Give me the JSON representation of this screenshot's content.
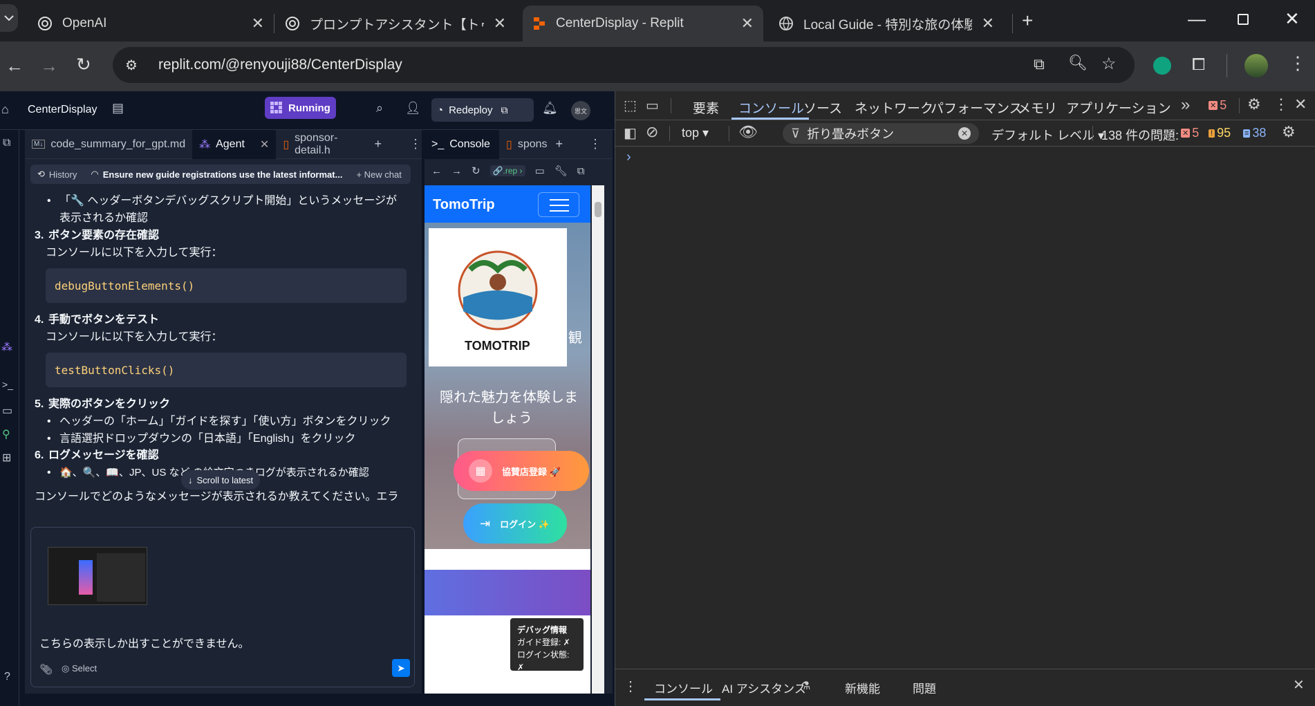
{
  "browser": {
    "tabs": [
      {
        "title": "OpenAI"
      },
      {
        "title": "プロンプトアシスタント【トゥモロープル"
      },
      {
        "title": "CenterDisplay - Replit"
      },
      {
        "title": "Local Guide - 特別な旅の体験を"
      }
    ],
    "url": "replit.com/@renyouji88/CenterDisplay"
  },
  "replit": {
    "project_name": "CenterDisplay",
    "running_label": "Running",
    "redeploy_label": "Redeploy",
    "avatar_text": "恩文",
    "left_tabs": [
      {
        "label": "code_summary_for_gpt.md"
      },
      {
        "label": "Agent"
      },
      {
        "label": "sponsor-detail.h"
      }
    ],
    "history_label": "History",
    "chat_title": "Ensure new guide registrations use the latest informat...",
    "new_chat_label": "New chat",
    "messages": {
      "b1": "「🔧 ヘッダーボタンデバッグスクリプト開始」というメッセージが",
      "b1b": "表示されるか確認",
      "s3_num": "3.",
      "s3_title": "ボタン要素の存在確認",
      "s3_sub": "コンソールに以下を入力して実行：",
      "code1": "debugButtonElements()",
      "s4_num": "4.",
      "s4_title": "手動でボタンをテスト",
      "s4_sub": "コンソールに以下を入力して実行：",
      "code2": "testButtonClicks()",
      "s5_num": "5.",
      "s5_title": "実際のボタンをクリック",
      "s5_b1": "ヘッダーの「ホーム」「ガイドを探す」「使い方」ボタンをクリック",
      "s5_b2": "言語選択ドロップダウンの「日本語」「English」をクリック",
      "s6_num": "6.",
      "s6_title": "ログメッセージを確認",
      "s6_b1": "🏠、🔍、📖、JP、US など の絵文字つきログが表示されるか確認",
      "bottom": "コンソールでどのようなメッセージが表示されるか教えてください。エラ"
    },
    "scroll_latest": "Scroll to latest",
    "input_text": "こちらの表示しか出すことができません。",
    "select_label": "Select",
    "right_tabs": [
      {
        "label": "Console"
      },
      {
        "label": "spons"
      }
    ],
    "webview_url": ".rep",
    "webview": {
      "brand": "TomoTrip",
      "logo_text": "TOMOTRIP",
      "hero_text": "隠れた魅力を体験しま",
      "hero_text2": "しょう",
      "hero_side": "観",
      "sponsor_btn": "協賛店登録 🚀",
      "login_btn": "ログイン ✨",
      "debug_title": "デバッグ情報",
      "debug_line1": "ガイド登録: ✗",
      "debug_line2": "ログイン状態: ✗"
    }
  },
  "devtools": {
    "tabs": [
      "要素",
      "コンソール",
      "ソース",
      "ネットワーク",
      "パフォーマンス",
      "メモリ",
      "アプリケーション"
    ],
    "error_badge": "5",
    "context": "top",
    "filter_text": "折り畳みボタン",
    "level": "デフォルト レベル",
    "issues_label": "138 件の問題:",
    "issue_errors": "5",
    "issue_warnings": "95",
    "issue_info": "38",
    "prompt": "›",
    "drawer_tabs": [
      "コンソール",
      "AI アシスタンス",
      "新機能",
      "問題"
    ]
  },
  "colors": {
    "accent": "#0079f2",
    "running": "#5f3dc4",
    "error": "#f28b82",
    "warning": "#fdd663",
    "info": "#8ab4f8"
  }
}
